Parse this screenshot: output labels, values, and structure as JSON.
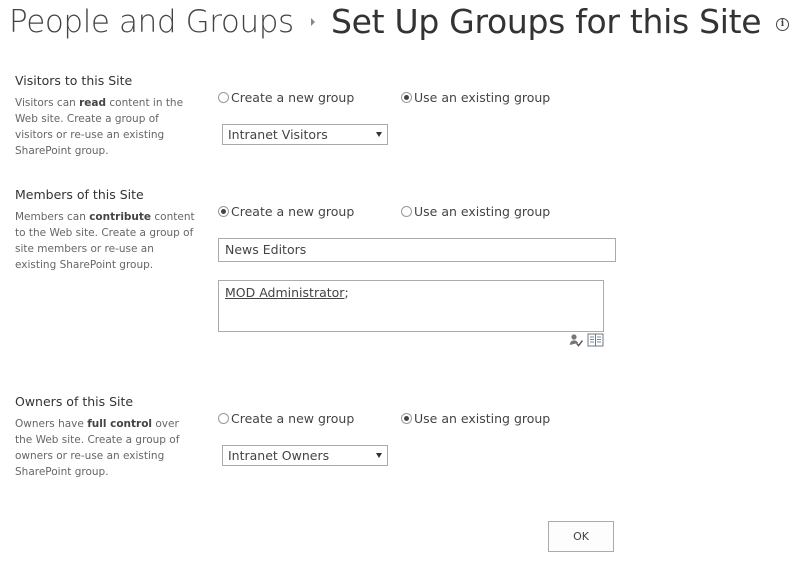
{
  "header": {
    "breadcrumb_parent": "People and Groups",
    "page_title": "Set Up Groups for this Site",
    "info_glyph": "i"
  },
  "visitors": {
    "title": "Visitors to this Site",
    "desc_prefix": "Visitors can ",
    "desc_bold": "read",
    "desc_suffix": " content in the Web site. Create a group of visitors or re-use an existing SharePoint group.",
    "option_new": "Create a new group",
    "option_existing": "Use an existing group",
    "selected": "existing",
    "select_value": "Intranet Visitors"
  },
  "members": {
    "title": "Members of this Site",
    "desc_prefix": "Members can ",
    "desc_bold": "contribute",
    "desc_suffix": " content to the Web site. Create a group of site members or re-use an existing SharePoint group.",
    "option_new": "Create a new group",
    "option_existing": "Use an existing group",
    "selected": "new",
    "group_name_value": "News Editors",
    "people_value": "MOD Administrator",
    "people_separator": ";"
  },
  "owners": {
    "title": "Owners of this Site",
    "desc_prefix": "Owners have ",
    "desc_bold": "full control",
    "desc_suffix": " over the Web site. Create a group of owners or re-use an existing SharePoint group.",
    "option_new": "Create a new group",
    "option_existing": "Use an existing group",
    "selected": "existing",
    "select_value": "Intranet Owners"
  },
  "icons": {
    "check_names": "check-names-icon",
    "browse": "address-book-icon",
    "breadcrumb_separator": "triangle-right-icon",
    "dropdown": "chevron-down-icon"
  },
  "actions": {
    "ok_label": "OK"
  }
}
